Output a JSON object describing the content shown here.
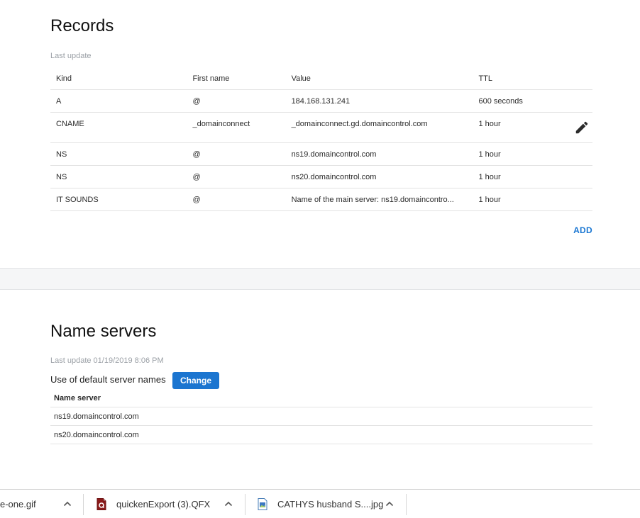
{
  "records": {
    "title": "Records",
    "last_update": "Last update",
    "columns": [
      "Kind",
      "First name",
      "Value",
      "TTL"
    ],
    "rows": [
      {
        "kind": "A",
        "name": "@",
        "value": "184.168.131.241",
        "ttl": "600 seconds"
      },
      {
        "kind": "CNAME",
        "name": "_domainconnect",
        "value": "_domainconnect.gd.domaincontrol.com",
        "ttl": "1 hour"
      },
      {
        "kind": "NS",
        "name": "@",
        "value": "ns19.domaincontrol.com",
        "ttl": "1 hour"
      },
      {
        "kind": "NS",
        "name": "@",
        "value": "ns20.domaincontrol.com",
        "ttl": "1 hour"
      },
      {
        "kind": "IT SOUNDS",
        "name": "@",
        "value": "Name of the main server: ns19.domaincontro...",
        "ttl": "1 hour"
      }
    ],
    "add_label": "ADD"
  },
  "name_servers": {
    "title": "Name servers",
    "last_update": "Last update 01/19/2019 8:06 PM",
    "default_text": "Use of default server names",
    "change_label": "Change",
    "column": "Name server",
    "servers": [
      "ns19.domaincontrol.com",
      "ns20.domaincontrol.com"
    ]
  },
  "downloads": [
    {
      "name": "e-one.gif",
      "icon": "gif-file-icon"
    },
    {
      "name": "quickenExport (3).QFX",
      "icon": "qfx-file-icon"
    },
    {
      "name": "CATHYS husband S....jpg",
      "icon": "image-file-icon"
    }
  ],
  "colors": {
    "accent": "#1b75d0",
    "link": "#1976d2",
    "muted_text": "#9ba0a6",
    "band": "#f5f6f7"
  },
  "icons": {
    "edit": "pencil-icon",
    "caret": "chevron-up-icon"
  }
}
